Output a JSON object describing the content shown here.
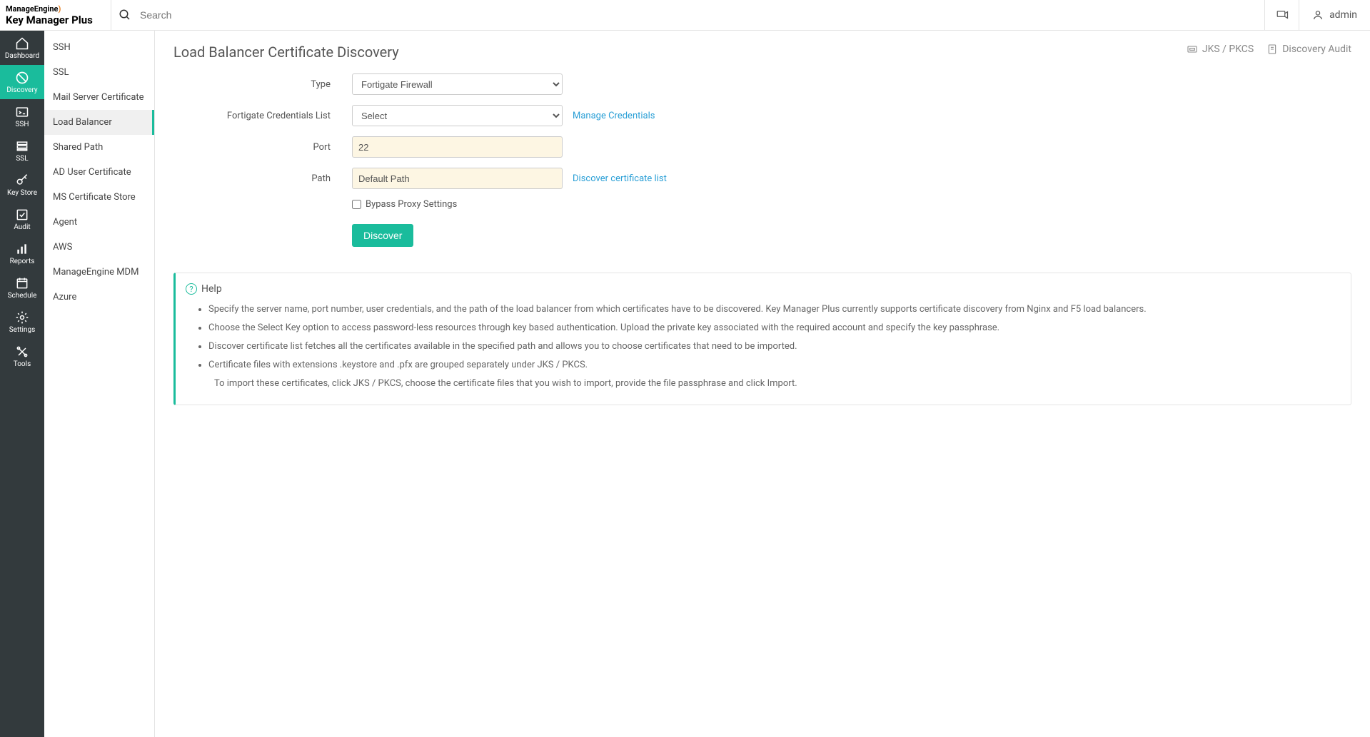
{
  "header": {
    "brand": "ManageEngine",
    "product": "Key Manager Plus",
    "search_placeholder": "Search",
    "user": "admin"
  },
  "nav": {
    "items": [
      {
        "label": "Dashboard"
      },
      {
        "label": "Discovery"
      },
      {
        "label": "SSH"
      },
      {
        "label": "SSL"
      },
      {
        "label": "Key Store"
      },
      {
        "label": "Audit"
      },
      {
        "label": "Reports"
      },
      {
        "label": "Schedule"
      },
      {
        "label": "Settings"
      },
      {
        "label": "Tools"
      }
    ]
  },
  "subnav": {
    "items": [
      "SSH",
      "SSL",
      "Mail Server Certificate",
      "Load Balancer",
      "Shared Path",
      "AD User Certificate",
      "MS Certificate Store",
      "Agent",
      "AWS",
      "ManageEngine MDM",
      "Azure"
    ]
  },
  "page": {
    "title": "Load Balancer Certificate Discovery",
    "jks_link": "JKS / PKCS",
    "audit_link": "Discovery Audit"
  },
  "form": {
    "type_label": "Type",
    "type_value": "Fortigate Firewall",
    "cred_label": "Fortigate Credentials List",
    "cred_value": "Select",
    "manage_cred": "Manage Credentials",
    "port_label": "Port",
    "port_value": "22",
    "path_label": "Path",
    "path_value": "Default Path",
    "discover_list": "Discover certificate list",
    "bypass_label": "Bypass Proxy Settings",
    "discover_btn": "Discover"
  },
  "help": {
    "title": "Help",
    "items": [
      "Specify the server name, port number, user credentials, and the path of the load balancer from which certificates have to be discovered. Key Manager Plus currently supports certificate discovery from Nginx and F5 load balancers.",
      "Choose the Select Key option to access password-less resources through key based authentication. Upload the private key associated with the required account and specify the key passphrase.",
      "Discover certificate list fetches all the certificates available in the specified path and allows you to choose certificates that need to be imported.",
      "Certificate files with extensions .keystore and .pfx are grouped separately under JKS / PKCS."
    ],
    "sub": "To import these certificates, click JKS / PKCS, choose the certificate files that you wish to import, provide the file passphrase and click Import."
  }
}
